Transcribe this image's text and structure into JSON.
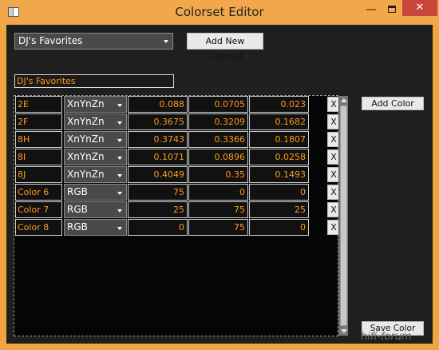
{
  "window": {
    "title": "Colorset Editor"
  },
  "toolbar": {
    "colorset_selected": "DJ's Favorites",
    "add_colorset_label": "Add New Colorset"
  },
  "colorset_name": "DJ's Favorites",
  "colors": [
    {
      "name": "2E",
      "space": "XnYnZn",
      "values": [
        "0.088",
        "0.0705",
        "0.023"
      ],
      "remove": "X"
    },
    {
      "name": "2F",
      "space": "XnYnZn",
      "values": [
        "0.3675",
        "0.3209",
        "0.1682"
      ],
      "remove": "X"
    },
    {
      "name": "8H",
      "space": "XnYnZn",
      "values": [
        "0.3743",
        "0.3366",
        "0.1807"
      ],
      "remove": "X"
    },
    {
      "name": "8I",
      "space": "XnYnZn",
      "values": [
        "0.1071",
        "0.0896",
        "0.0258"
      ],
      "remove": "X"
    },
    {
      "name": "8J",
      "space": "XnYnZn",
      "values": [
        "0.4049",
        "0.35",
        "0.1493"
      ],
      "remove": "X"
    },
    {
      "name": "Color 6",
      "space": "RGB",
      "values": [
        "75",
        "0",
        "0"
      ],
      "remove": "X"
    },
    {
      "name": "Color 7",
      "space": "RGB",
      "values": [
        "25",
        "75",
        "25"
      ],
      "remove": "X"
    },
    {
      "name": "Color 8",
      "space": "RGB",
      "values": [
        "0",
        "75",
        "0"
      ],
      "remove": "X"
    }
  ],
  "actions": {
    "add_color_label": "Add Color",
    "save_label": "Save Color Set"
  },
  "watermark": "hifi-forum",
  "colors_theme": {
    "accent_text": "#ff9a1a",
    "title_bar": "#f2a84a",
    "close_button": "#c9453c"
  }
}
